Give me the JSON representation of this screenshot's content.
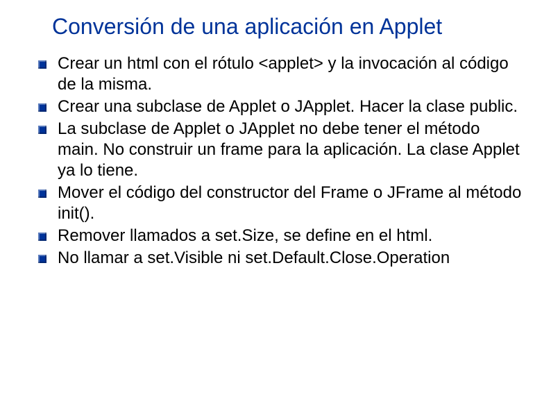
{
  "slide": {
    "title": "Conversión de una aplicación en Applet",
    "bullets": [
      "Crear un html con el rótulo <applet> y la invocación al código de la misma.",
      "Crear una subclase de Applet o JApplet. Hacer la clase public.",
      "La subclase de Applet o JApplet no debe tener el método main. No construir un frame para la aplicación. La clase Applet ya lo tiene.",
      "Mover el código del constructor del Frame o JFrame al método init().",
      "Remover llamados a set.Size, se define en el html.",
      "No llamar a set.Visible ni set.Default.Close.Operation"
    ]
  }
}
